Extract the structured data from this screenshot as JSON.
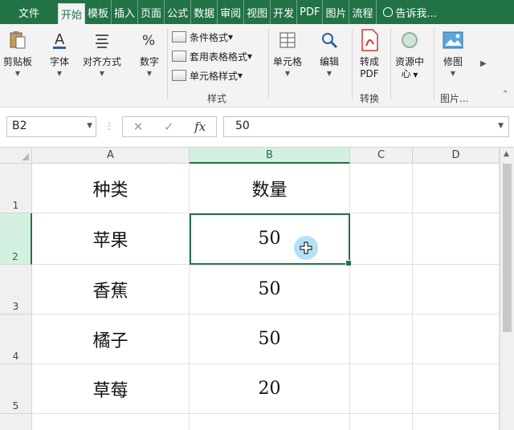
{
  "tabs": [
    {
      "label": "文件",
      "active": false
    },
    {
      "label": "开始",
      "active": true
    },
    {
      "label": "模板",
      "active": false
    },
    {
      "label": "插入",
      "active": false
    },
    {
      "label": "页面",
      "active": false
    },
    {
      "label": "公式",
      "active": false
    },
    {
      "label": "数据",
      "active": false
    },
    {
      "label": "审阅",
      "active": false
    },
    {
      "label": "视图",
      "active": false
    },
    {
      "label": "开发",
      "active": false
    },
    {
      "label": "PDF",
      "active": false
    },
    {
      "label": "图片",
      "active": false
    },
    {
      "label": "流程",
      "active": false
    }
  ],
  "tell_me": "告诉我...",
  "ribbon": {
    "clipboard": "剪贴板",
    "font": "字体",
    "align": "对齐方式",
    "number": "数字",
    "cond_format": "条件格式",
    "table_format": "套用表格格式",
    "cell_style": "单元格样式",
    "styles_group": "样式",
    "cells": "单元格",
    "editing": "编辑",
    "convert_line1": "转成",
    "convert_line2": "PDF",
    "convert_group": "转换",
    "resource_line1": "资源中",
    "resource_line2": "心",
    "retouch": "修图",
    "picture_group": "图片..."
  },
  "formula_bar": {
    "name_box": "B2",
    "value": "50",
    "fx": "fx"
  },
  "columns": [
    "A",
    "B",
    "C",
    "D"
  ],
  "rows": [
    {
      "num": "1",
      "a": "种类",
      "b": "数量"
    },
    {
      "num": "2",
      "a": "苹果",
      "b": "50"
    },
    {
      "num": "3",
      "a": "香蕉",
      "b": "50"
    },
    {
      "num": "4",
      "a": "橘子",
      "b": "50"
    },
    {
      "num": "5",
      "a": "草莓",
      "b": "20"
    }
  ],
  "selected_cell": "B2",
  "colors": {
    "accent": "#217346"
  }
}
